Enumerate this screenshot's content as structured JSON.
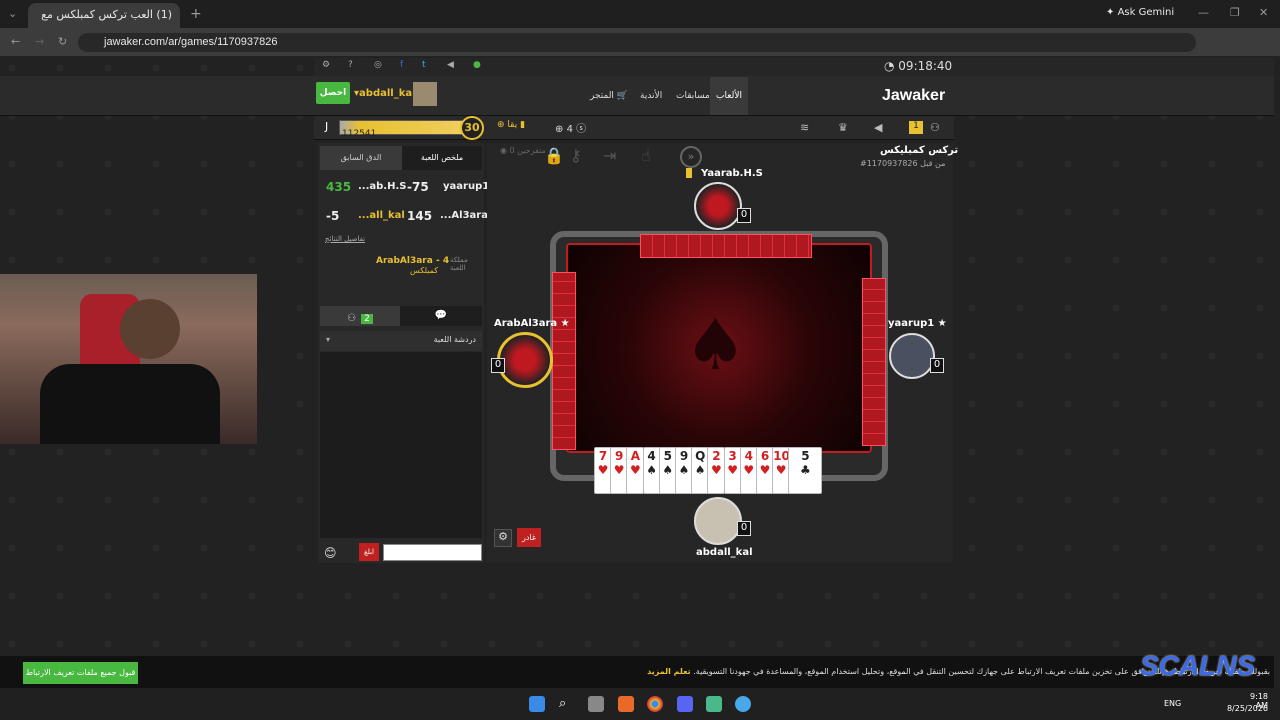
{
  "browser": {
    "tab_title": "(1) العب تركس كمبلكس مع",
    "url": "jawaker.com/ar/games/1170937826",
    "ask_gemini": "Ask Gemini"
  },
  "header": {
    "clock": "09:18:40",
    "username": "abdall_kal",
    "get_button": "احصل",
    "nav": [
      "الألعاب",
      "مسابقات",
      "الأندية",
      "المتجر"
    ],
    "logo": "Jawaker"
  },
  "status": {
    "coins": "112541",
    "level": "30",
    "chips": "4",
    "sub_label": "يقا"
  },
  "game": {
    "title": "تركس كمبليكس",
    "id_line": "#1170937826 من قبل",
    "spectators": "0 متفرجين"
  },
  "left_panel": {
    "tabs": [
      "ملخص اللعبة",
      "الدق السابق"
    ],
    "rows": [
      {
        "c1": "435",
        "c2": "...ab.H.S",
        "c3": "-75",
        "c4": "yaarup1"
      },
      {
        "c1": "-5",
        "c2": "...all_kal",
        "c3": "145",
        "c4": "...Al3ara"
      }
    ],
    "details_link": "تفاصيل النتائج",
    "kingdom_label": "مملكة اللعبة",
    "kingdom_value": "ArabAl3ara - 4",
    "kingdom_sub": "كمبلكس",
    "chat_count": "2",
    "chat_header": "دردشة اللعبة",
    "send_button": "ابلغ"
  },
  "players": {
    "top": {
      "name": "Yaarab.H.S",
      "score": "0"
    },
    "left": {
      "name": "ArabAl3ara",
      "score": "0"
    },
    "right": {
      "name": "yaarup1",
      "score": "0"
    },
    "bottom": {
      "name": "abdall_kal",
      "score": "0"
    }
  },
  "hand": [
    {
      "rank": "7",
      "suit": "♥"
    },
    {
      "rank": "9",
      "suit": "♥"
    },
    {
      "rank": "A",
      "suit": "♥"
    },
    {
      "rank": "4",
      "suit": "♠"
    },
    {
      "rank": "5",
      "suit": "♠"
    },
    {
      "rank": "9",
      "suit": "♠"
    },
    {
      "rank": "Q",
      "suit": "♠"
    },
    {
      "rank": "2",
      "suit": "♥"
    },
    {
      "rank": "3",
      "suit": "♥"
    },
    {
      "rank": "4",
      "suit": "♥"
    },
    {
      "rank": "6",
      "suit": "♥"
    },
    {
      "rank": "10",
      "suit": "♥"
    },
    {
      "rank": "5",
      "suit": "♣"
    }
  ],
  "buttons": {
    "leave": "غادر"
  },
  "cookie": {
    "text": "بقبولك ملفات تعريف الارتباط، فإنك توافق على تخزين ملفات تعريف الارتباط على جهازك لتحسين التنقل في الموقع، وتحليل استخدام الموقع، والمساعدة في جهودنا التسويقية.",
    "learn_more": "تعلم المزيد",
    "accept": "قبول جميع ملفات تعريف الارتباط"
  },
  "watermark": "SCALNS",
  "taskbar": {
    "lang": "ENG",
    "time": "9:18 AM",
    "date": "8/25/2026"
  }
}
